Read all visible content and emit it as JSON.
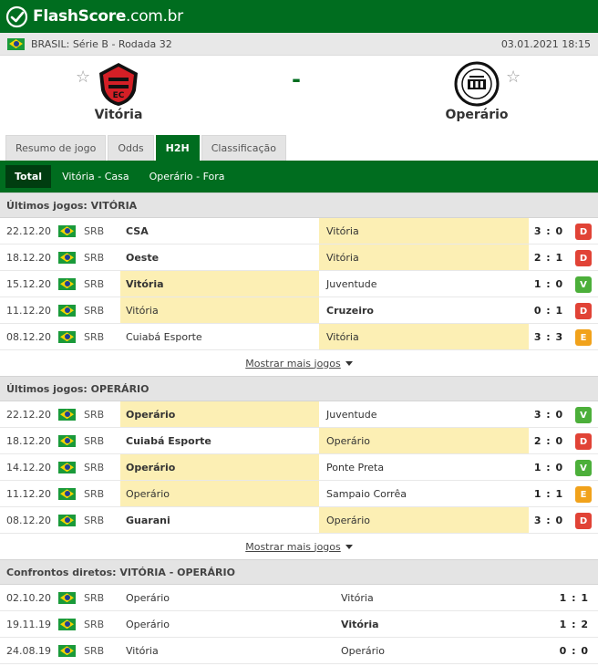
{
  "brand": {
    "name": "FlashScore",
    "ext": ".com.br"
  },
  "info": {
    "league": "BRASIL: Série B - Rodada 32",
    "datetime": "03.01.2021 18:15"
  },
  "match": {
    "home": "Vitória",
    "away": "Operário",
    "score": "-"
  },
  "tabs": [
    "Resumo de jogo",
    "Odds",
    "H2H",
    "Classificação"
  ],
  "subtabs": [
    "Total",
    "Vitória - Casa",
    "Operário - Fora"
  ],
  "more_label": "Mostrar mais jogos",
  "sections": [
    {
      "title": "Últimos jogos: VITÓRIA",
      "rows": [
        {
          "date": "22.12.20",
          "comp": "SRB",
          "home": "CSA",
          "away": "Vitória",
          "score": "3 : 0",
          "result": "D"
        },
        {
          "date": "18.12.20",
          "comp": "SRB",
          "home": "Oeste",
          "away": "Vitória",
          "score": "2 : 1",
          "result": "D"
        },
        {
          "date": "15.12.20",
          "comp": "SRB",
          "home": "Vitória",
          "away": "Juventude",
          "score": "1 : 0",
          "result": "V"
        },
        {
          "date": "11.12.20",
          "comp": "SRB",
          "home": "Vitória",
          "away": "Cruzeiro",
          "score": "0 : 1",
          "result": "D"
        },
        {
          "date": "08.12.20",
          "comp": "SRB",
          "home": "Cuiabá Esporte",
          "away": "Vitória",
          "score": "3 : 3",
          "result": "E"
        }
      ]
    },
    {
      "title": "Últimos jogos: OPERÁRIO",
      "rows": [
        {
          "date": "22.12.20",
          "comp": "SRB",
          "home": "Operário",
          "away": "Juventude",
          "score": "3 : 0",
          "result": "V"
        },
        {
          "date": "18.12.20",
          "comp": "SRB",
          "home": "Cuiabá Esporte",
          "away": "Operário",
          "score": "2 : 0",
          "result": "D"
        },
        {
          "date": "14.12.20",
          "comp": "SRB",
          "home": "Operário",
          "away": "Ponte Preta",
          "score": "1 : 0",
          "result": "V"
        },
        {
          "date": "11.12.20",
          "comp": "SRB",
          "home": "Operário",
          "away": "Sampaio Corrêa",
          "score": "1 : 1",
          "result": "E"
        },
        {
          "date": "08.12.20",
          "comp": "SRB",
          "home": "Guarani",
          "away": "Operário",
          "score": "3 : 0",
          "result": "D"
        }
      ]
    }
  ],
  "h2h": {
    "title": "Confrontos diretos: VITÓRIA - OPERÁRIO",
    "rows": [
      {
        "date": "02.10.20",
        "comp": "SRB",
        "home": "Operário",
        "away": "Vitória",
        "score": "1 : 1"
      },
      {
        "date": "19.11.19",
        "comp": "SRB",
        "home": "Operário",
        "away": "Vitória",
        "score": "1 : 2"
      },
      {
        "date": "24.08.19",
        "comp": "SRB",
        "home": "Vitória",
        "away": "Operário",
        "score": "0 : 0"
      }
    ]
  },
  "colors": {
    "brand_green": "#006d1f",
    "loss": "#e14336",
    "win": "#4caf3a",
    "draw": "#f1a21b",
    "highlight": "#fcefb4"
  }
}
